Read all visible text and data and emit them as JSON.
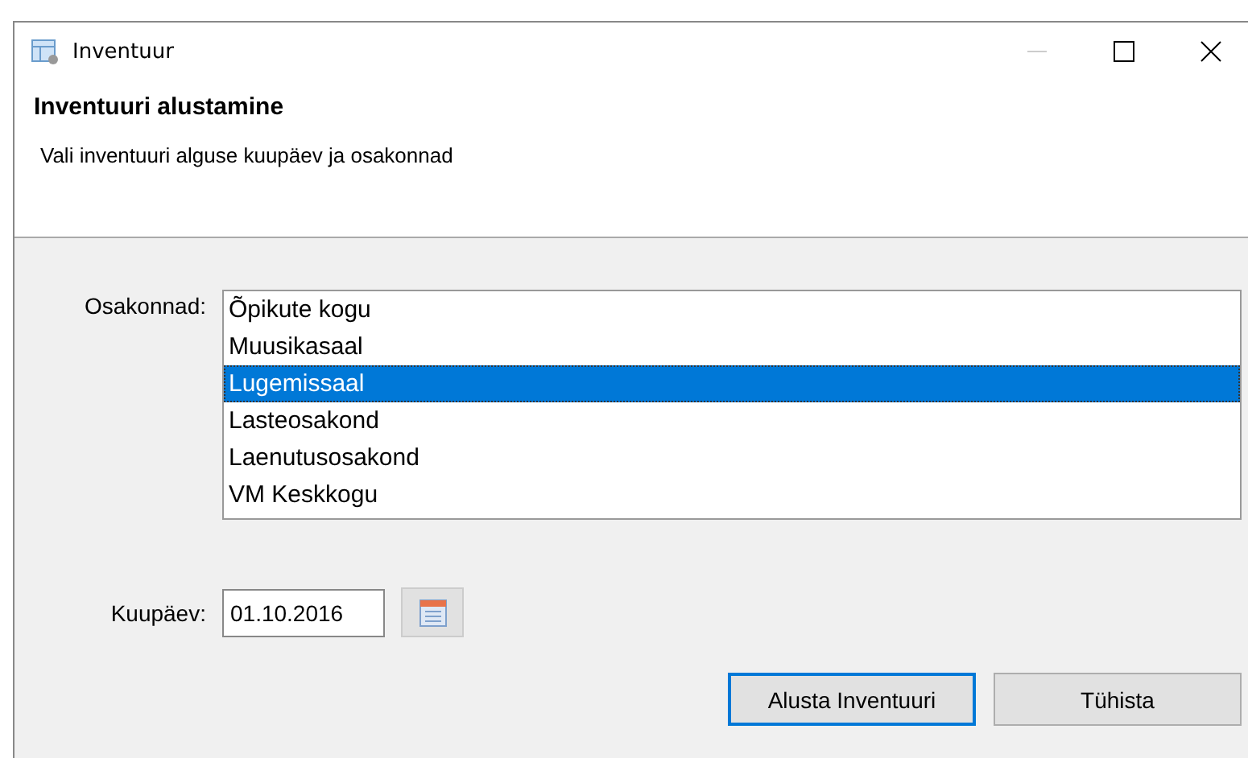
{
  "window": {
    "title": "Inventuur"
  },
  "header": {
    "title": "Inventuuri alustamine",
    "subtitle": "Vali inventuuri alguse kuupäev ja osakonnad"
  },
  "departments": {
    "label": "Osakonnad:",
    "items": [
      {
        "label": "Õpikute kogu",
        "selected": false
      },
      {
        "label": "Muusikasaal",
        "selected": false
      },
      {
        "label": "Lugemissaal",
        "selected": true
      },
      {
        "label": "Lasteosakond",
        "selected": false
      },
      {
        "label": "Laenutusosakond",
        "selected": false
      },
      {
        "label": "VM Keskkogu",
        "selected": false
      }
    ]
  },
  "date": {
    "label": "Kuupäev:",
    "value": "01.10.2016"
  },
  "buttons": [
    {
      "label": "Alusta Inventuuri",
      "default": true
    },
    {
      "label": "Tühista",
      "default": false
    }
  ]
}
